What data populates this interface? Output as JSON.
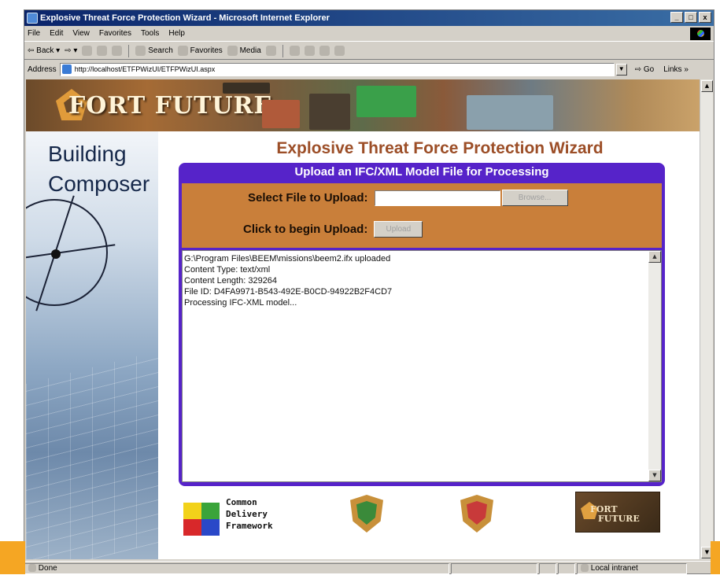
{
  "window": {
    "title": "Explosive Threat Force Protection Wizard - Microsoft Internet Explorer",
    "buttons": [
      "_",
      "□",
      "x"
    ]
  },
  "menu": [
    "File",
    "Edit",
    "View",
    "Favorites",
    "Tools",
    "Help"
  ],
  "toolbar": {
    "back": "Back",
    "search": "Search",
    "favorites": "Favorites",
    "media": "Media"
  },
  "address": {
    "label": "Address",
    "url": "http://localhost/ETFPWizUI/ETFPWizUI.aspx",
    "go": "Go",
    "links": "Links »"
  },
  "banner": {
    "title": "FORT FUTURE"
  },
  "sidebar": {
    "line1": "Building",
    "line2": "Composer"
  },
  "page": {
    "title": "Explosive Threat Force Protection Wizard",
    "panel_title": "Upload an IFC/XML Model File for Processing",
    "select_label": "Select File to Upload:",
    "browse_label": "Browse...",
    "begin_label": "Click to begin Upload:",
    "upload_label": "Upload",
    "output_lines": [
      "G:\\Program Files\\BEEM\\missions\\beem2.ifx uploaded",
      "Content Type: text/xml",
      "Content Length: 329264",
      "File ID: D4FA9971-B543-492E-B0CD-94922B2F4CD7",
      "Processing IFC-XML model..."
    ]
  },
  "footer": {
    "cdf_line1": "Common",
    "cdf_line2": "Delivery",
    "cdf_line3": "Framework",
    "ff_line1": "FORT",
    "ff_line2": "FUTURE"
  },
  "status": {
    "left": "Done",
    "zone": "Local intranet"
  },
  "colors": {
    "panel": "#5623c9",
    "upload_area": "#c97f3a",
    "title": "#9c4e27",
    "accent": "#f5a623"
  }
}
